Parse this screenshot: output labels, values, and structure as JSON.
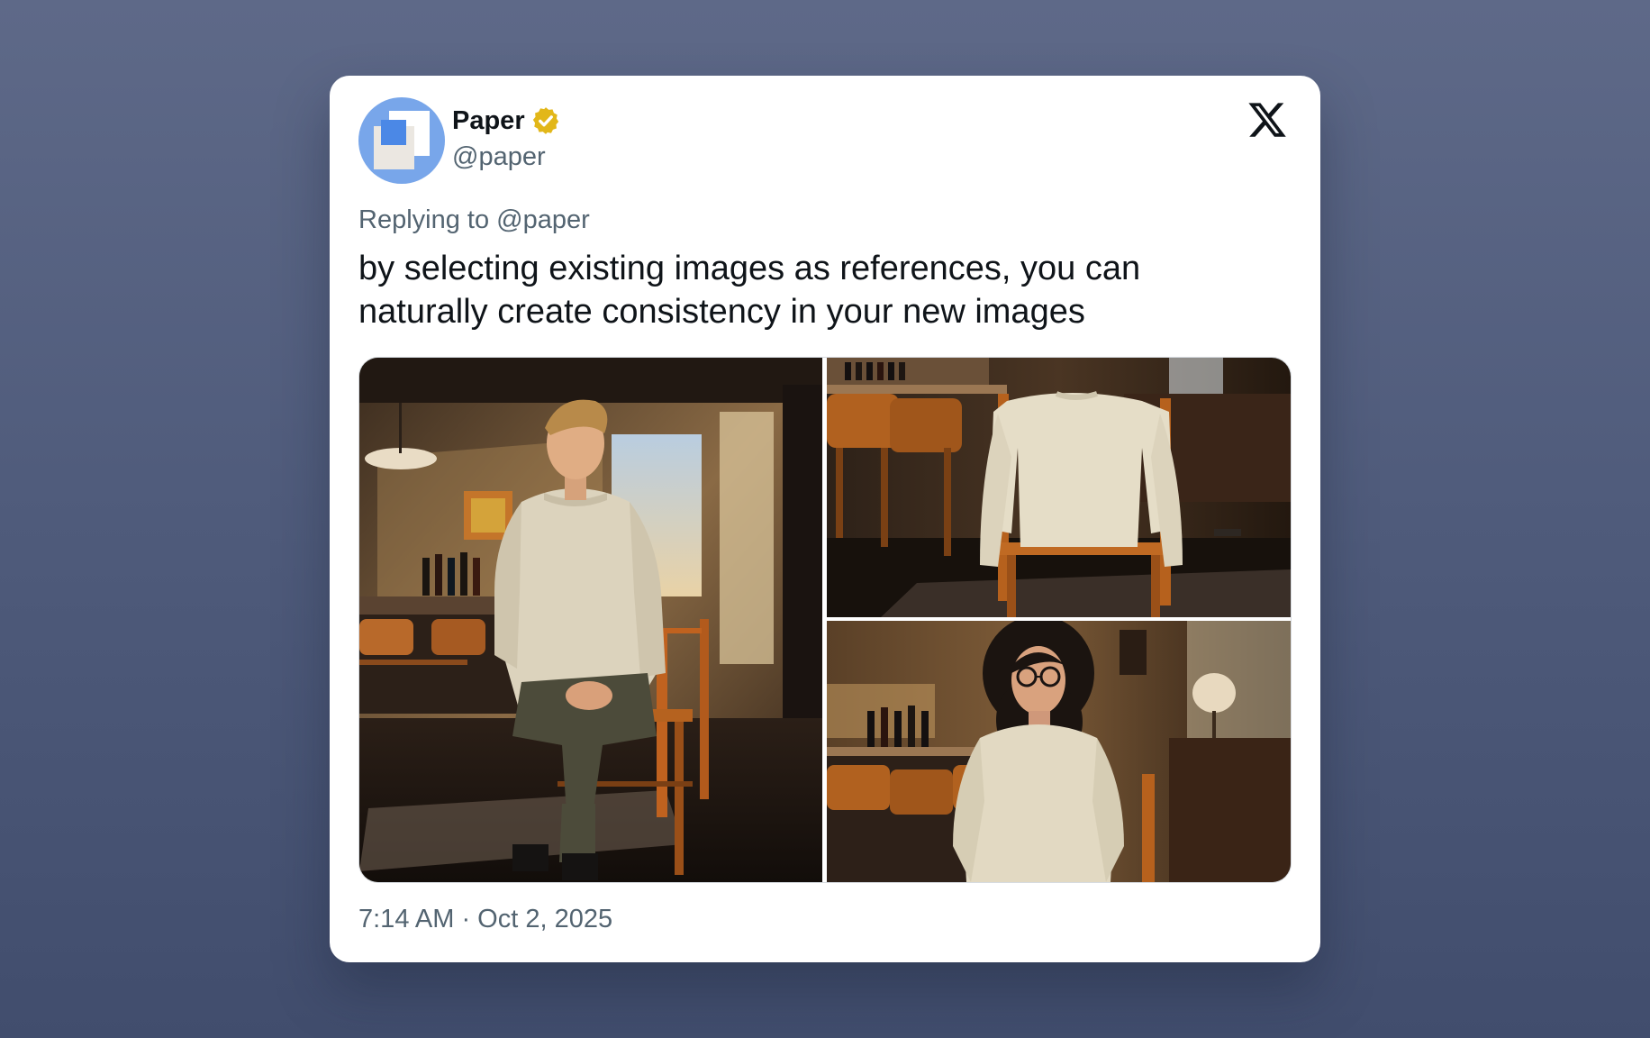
{
  "account": {
    "display_name": "Paper",
    "handle": "@paper",
    "verified": true,
    "avatar_color": "#78a6ea"
  },
  "reply": {
    "text": "Replying to @paper"
  },
  "tweet": {
    "text": "by selecting existing images as references, you can naturally create consistency in your new images",
    "timestamp": "7:14 AM · Oct 2, 2025"
  },
  "icons": {
    "verified": "verified-badge-icon",
    "platform": "x-logo-icon"
  },
  "media": {
    "count": 3,
    "images": [
      {
        "subject": "man in cream sweater seated on wooden bar stool"
      },
      {
        "subject": "cream sweater draped over wooden chair"
      },
      {
        "subject": "woman with curly hair and glasses in cream sweater"
      }
    ]
  },
  "colors": {
    "text_primary": "#0f1419",
    "text_secondary": "#536471",
    "badge_gold": "#e2b719"
  }
}
